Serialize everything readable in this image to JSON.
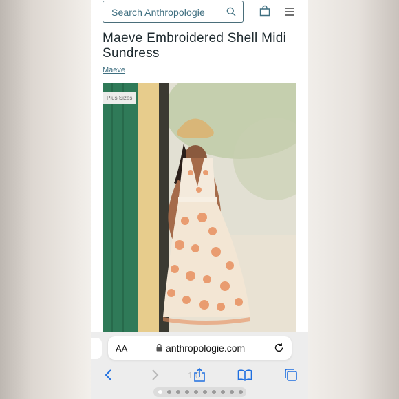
{
  "header": {
    "search_placeholder": "Search Anthropologie",
    "icons": {
      "search": "search-icon",
      "bag": "shopping-bag-icon",
      "menu": "hamburger-menu-icon"
    }
  },
  "product": {
    "title": "Maeve Embroidered Shell Midi Sundress",
    "brand": "Maeve",
    "badge": "Plus Sizes"
  },
  "browser": {
    "text_size_label": "AA",
    "url": "anthropologie.com",
    "tab_count": "1 0",
    "icons": [
      "back-icon",
      "forward-icon",
      "share-icon",
      "bookmarks-icon",
      "tabs-icon"
    ]
  },
  "colors": {
    "accent": "#3f6f80",
    "title_text": "#1f2b30",
    "safari_blue": "#1f6fe0",
    "dress_embroidery": "#e8905f"
  }
}
